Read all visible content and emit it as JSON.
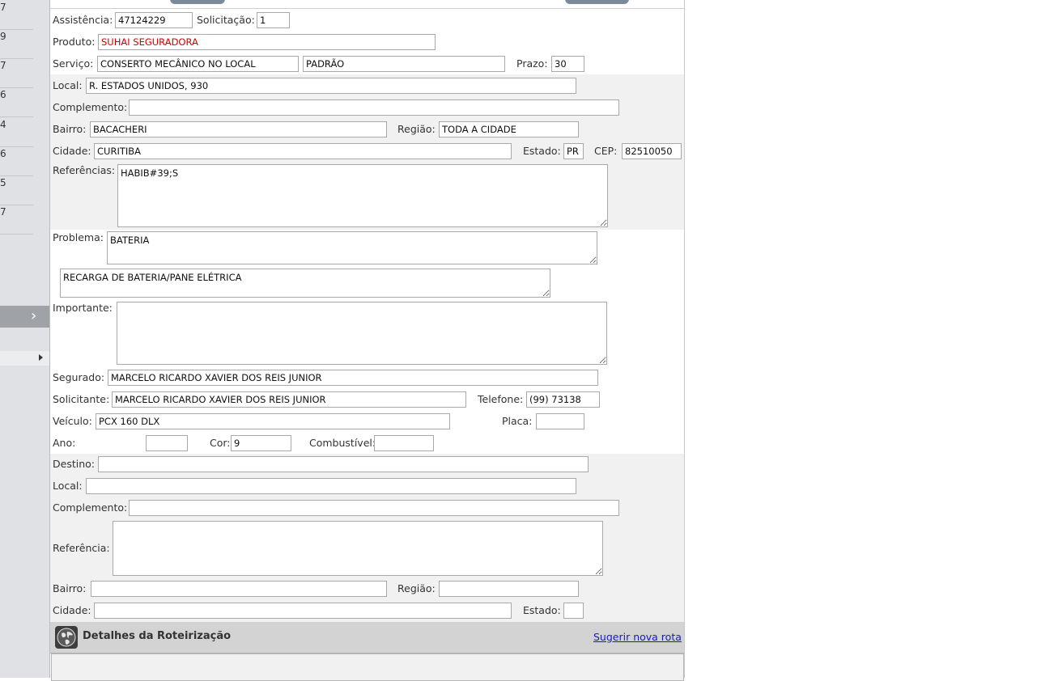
{
  "left_strip": {
    "numbers": [
      "7",
      "9",
      "7",
      "6",
      "4",
      "6",
      "5",
      "7"
    ]
  },
  "servico": {
    "assistencia_label": "Assistência:",
    "assistencia_value": "47124229",
    "solicitacao_label": "Solicitação:",
    "solicitacao_value": "1",
    "produto_label": "Produto:",
    "produto_value": "SUHAI SEGURADORA",
    "servico_label": "Serviço:",
    "servico_value": "CONSERTO MECÂNICO NO LOCAL",
    "tipo_value": "PADRÃO",
    "prazo_label": "Prazo:",
    "prazo_value": "30"
  },
  "origem": {
    "local_label": "Local:",
    "local_value": "R. ESTADOS UNIDOS, 930",
    "complemento_label": "Complemento:",
    "complemento_value": "",
    "bairro_label": "Bairro:",
    "bairro_value": "BACACHERI",
    "regiao_label": "Região:",
    "regiao_value": "TODA A CIDADE",
    "cidade_label": "Cidade:",
    "cidade_value": "CURITIBA",
    "estado_label": "Estado:",
    "estado_value": "PR",
    "cep_label": "CEP:",
    "cep_value": "82510050",
    "referencias_label": "Referências:",
    "referencias_value": "HABIB#39;S"
  },
  "problema": {
    "problema_label": "Problema:",
    "problema_value": "BATERIA",
    "descricao_value": "RECARGA DE BATERIA/PANE ELÉTRICA",
    "importante_label": "Importante:",
    "importante_value": ""
  },
  "segurado": {
    "segurado_label": "Segurado:",
    "segurado_value": "MARCELO RICARDO XAVIER DOS REIS JUNIOR",
    "solicitante_label": "Solicitante:",
    "solicitante_value": "MARCELO RICARDO XAVIER DOS REIS JUNIOR",
    "telefone_label": "Telefone:",
    "telefone_value": "(99) 73138",
    "veiculo_label": "Veículo:",
    "veiculo_value": "PCX 160 DLX",
    "placa_label": "Placa:",
    "placa_value": "",
    "ano_label": "Ano:",
    "ano_value": "",
    "cor_label": "Cor:",
    "cor_value": "9",
    "combustivel_label": "Combustível:",
    "combustivel_value": ""
  },
  "destino": {
    "destino_label": "Destino:",
    "destino_value": "",
    "local_label": "Local:",
    "local_value": "",
    "complemento_label": "Complemento:",
    "complemento_value": "",
    "referencia_label": "Referência:",
    "referencia_value": "",
    "bairro_label": "Bairro:",
    "bairro_value": "",
    "regiao_label": "Região:",
    "regiao_value": "",
    "cidade_label": "Cidade:",
    "cidade_value": "",
    "estado_label": "Estado:",
    "estado_value": ""
  },
  "roteirizacao": {
    "title": "Detalhes da Roteirização",
    "link": "Sugerir nova rota",
    "icon": "globe-icon"
  },
  "colors": {
    "produto_text": "#d00000",
    "link": "#1a1ab8",
    "band_bg": "#f1f1f1",
    "header_bg": "#d3d3d3"
  }
}
